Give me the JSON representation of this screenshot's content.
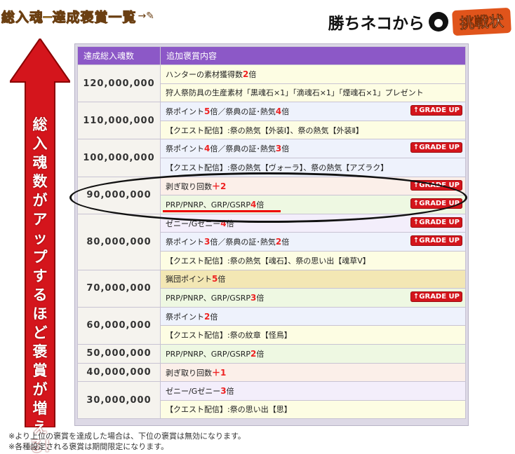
{
  "header": {
    "title": "総入魂─達成褒賞一覧",
    "prefix": "勝ちネコから",
    "badge": "挑戦状"
  },
  "arrow": {
    "text": "総入魂数がアップするほど褒賞が増える！"
  },
  "table": {
    "columns": [
      "達成総入魂数",
      "追加褒賞内容"
    ],
    "tiers": [
      {
        "amount": "120,000,000",
        "rows": [
          {
            "parts": [
              [
                "ハンターの素材獲得数",
                ""
              ],
              [
                "2",
                "red"
              ],
              [
                "倍",
                ""
              ]
            ],
            "bg": "y"
          },
          {
            "parts": [
              [
                "狩人祭防具の生産素材「黒魂石×1」「滴魂石×1」「煙魂石×1」プレゼント",
                ""
              ]
            ],
            "bg": "y"
          }
        ]
      },
      {
        "amount": "110,000,000",
        "rows": [
          {
            "parts": [
              [
                "祭ポイント",
                ""
              ],
              [
                "5",
                "red"
              ],
              [
                "倍／祭典の証･熱気",
                ""
              ],
              [
                "4",
                "red"
              ],
              [
                "倍",
                ""
              ]
            ],
            "bg": "b",
            "grade": true
          },
          {
            "parts": [
              [
                "【クエスト配信】:祭の熱気【外装Ⅰ】、祭の熱気【外装Ⅱ】",
                ""
              ]
            ],
            "bg": "y"
          }
        ]
      },
      {
        "amount": "100,000,000",
        "rows": [
          {
            "parts": [
              [
                "祭ポイント",
                ""
              ],
              [
                "4",
                "red"
              ],
              [
                "倍／祭典の証･熱気",
                ""
              ],
              [
                "3",
                "red"
              ],
              [
                "倍",
                ""
              ]
            ],
            "bg": "b",
            "grade": true
          },
          {
            "parts": [
              [
                "【クエスト配信】:祭の熱気【ヴォーラ】、祭の熱気【アズラク】",
                ""
              ]
            ],
            "bg": "b"
          }
        ]
      },
      {
        "amount": "90,000,000",
        "rows": [
          {
            "parts": [
              [
                "剥ぎ取り回数",
                ""
              ],
              [
                "＋2",
                "red"
              ]
            ],
            "bg": "p",
            "grade": true
          },
          {
            "parts": [
              [
                "PRP/PNRP、GRP/GSRP",
                ""
              ],
              [
                "4",
                "red"
              ],
              [
                "倍",
                ""
              ]
            ],
            "bg": "g",
            "grade": true
          }
        ]
      },
      {
        "amount": "80,000,000",
        "rows": [
          {
            "parts": [
              [
                "ゼニー/Gゼニー",
                ""
              ],
              [
                "4",
                "red"
              ],
              [
                "倍",
                ""
              ]
            ],
            "bg": "v",
            "grade": true
          },
          {
            "parts": [
              [
                "祭ポイント",
                ""
              ],
              [
                "3",
                "red"
              ],
              [
                "倍／祭典の証･熱気",
                ""
              ],
              [
                "2",
                "red"
              ],
              [
                "倍",
                ""
              ]
            ],
            "bg": "b",
            "grade": true
          },
          {
            "parts": [
              [
                "【クエスト配信】:祭の熱気【魂石】、祭の思い出【魂草Ⅴ】",
                ""
              ]
            ],
            "bg": "y"
          }
        ]
      },
      {
        "amount": "70,000,000",
        "rows": [
          {
            "parts": [
              [
                "猟団ポイント",
                ""
              ],
              [
                "5",
                "red"
              ],
              [
                "倍",
                ""
              ]
            ],
            "bg": "o"
          },
          {
            "parts": [
              [
                "PRP/PNRP、GRP/GSRP",
                ""
              ],
              [
                "3",
                "red"
              ],
              [
                "倍",
                ""
              ]
            ],
            "bg": "g",
            "grade": true
          }
        ]
      },
      {
        "amount": "60,000,000",
        "rows": [
          {
            "parts": [
              [
                "祭ポイント",
                ""
              ],
              [
                "2",
                "red"
              ],
              [
                "倍",
                ""
              ]
            ],
            "bg": "b"
          },
          {
            "parts": [
              [
                "【クエスト配信】:祭の紋章【怪鳥】",
                ""
              ]
            ],
            "bg": "y"
          }
        ]
      },
      {
        "amount": "50,000,000",
        "rows": [
          {
            "parts": [
              [
                "PRP/PNRP、GRP/GSRP",
                ""
              ],
              [
                "2",
                "red"
              ],
              [
                "倍",
                ""
              ]
            ],
            "bg": "g"
          }
        ]
      },
      {
        "amount": "40,000,000",
        "rows": [
          {
            "parts": [
              [
                "剥ぎ取り回数",
                ""
              ],
              [
                "＋1",
                "red"
              ]
            ],
            "bg": "p"
          }
        ]
      },
      {
        "amount": "30,000,000",
        "rows": [
          {
            "parts": [
              [
                "ゼニー/Gゼニー",
                ""
              ],
              [
                "3",
                "red"
              ],
              [
                "倍",
                ""
              ]
            ],
            "bg": "v"
          },
          {
            "parts": [
              [
                "【クエスト配信】:祭の思い出【思】",
                ""
              ]
            ],
            "bg": "y"
          }
        ]
      }
    ],
    "grade_label": "↑GRADE UP"
  },
  "notes": [
    "※より上位の褒賞を達成した場合は、下位の褒賞は無効になります。",
    "※各種設定される褒賞は期間限定になります。"
  ],
  "colors": {
    "header_purple": "#8c58c7",
    "arrow_red": "#d4151c",
    "number_red": "#e22222"
  }
}
